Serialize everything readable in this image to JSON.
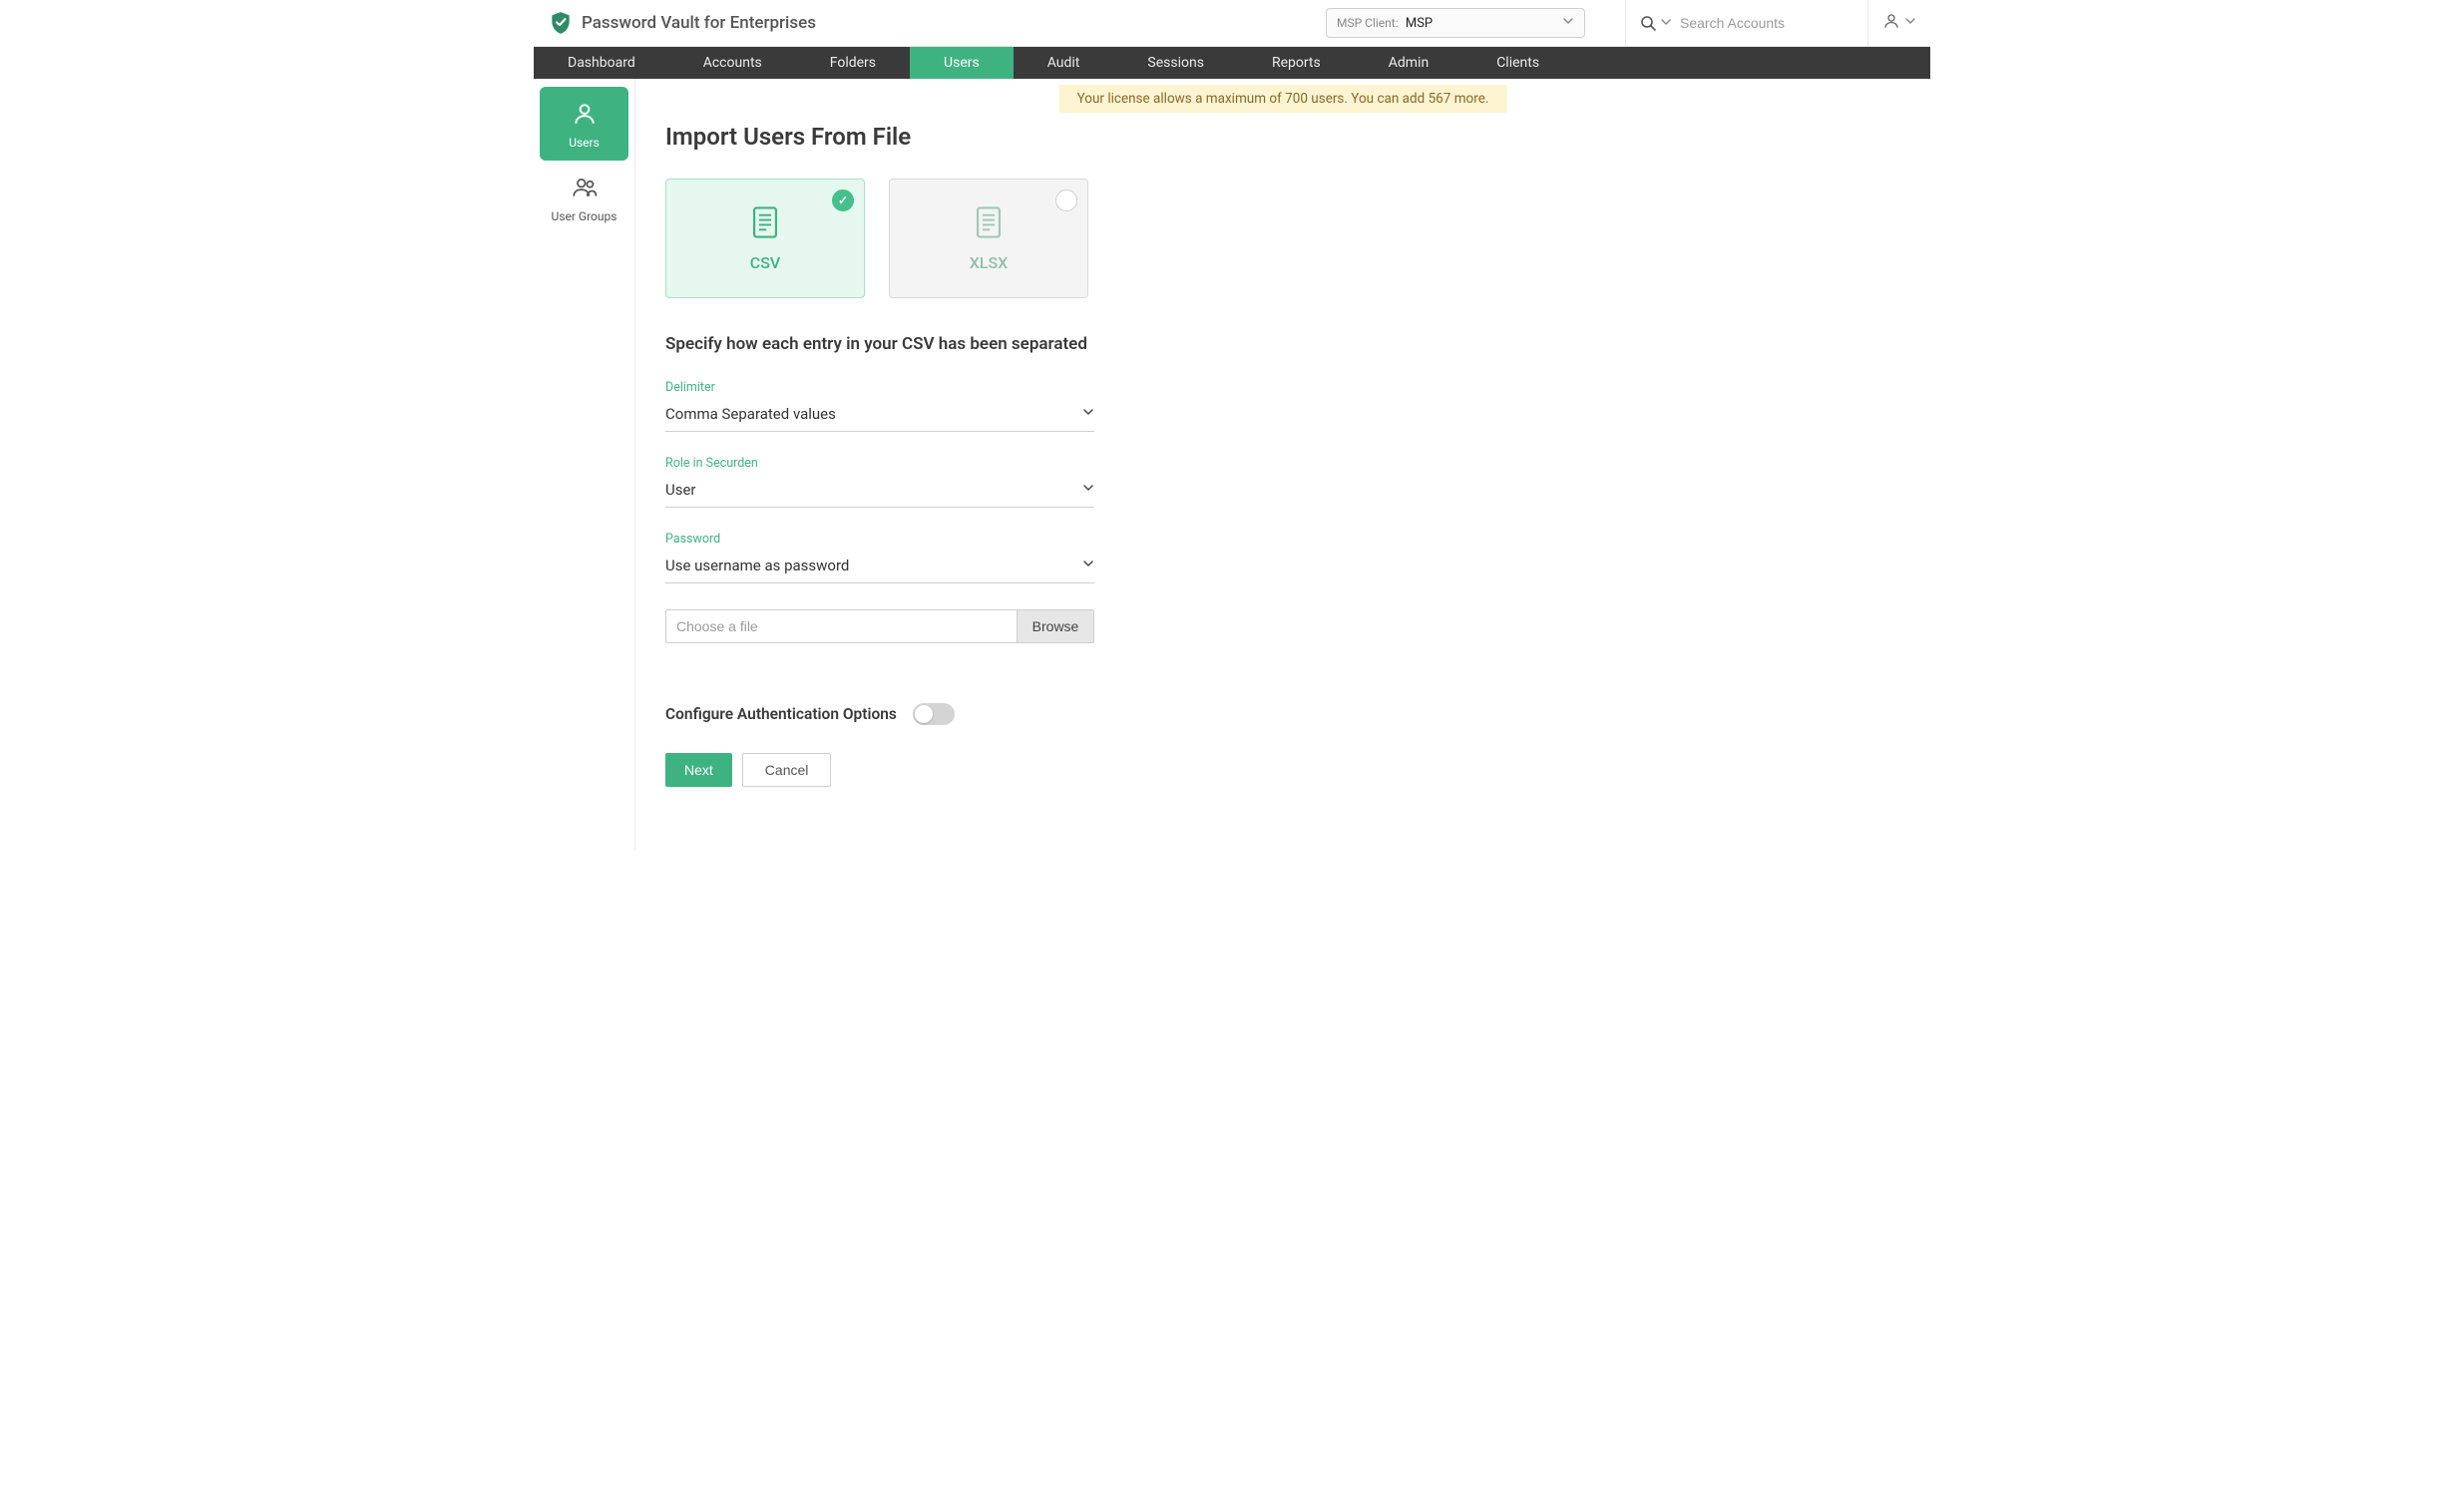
{
  "header": {
    "app_title": "Password Vault for Enterprises",
    "msp_label": "MSP Client:",
    "msp_value": "MSP",
    "search_placeholder": "Search Accounts"
  },
  "main_nav": [
    {
      "label": "Dashboard",
      "active": false
    },
    {
      "label": "Accounts",
      "active": false
    },
    {
      "label": "Folders",
      "active": false
    },
    {
      "label": "Users",
      "active": true
    },
    {
      "label": "Audit",
      "active": false
    },
    {
      "label": "Sessions",
      "active": false
    },
    {
      "label": "Reports",
      "active": false
    },
    {
      "label": "Admin",
      "active": false
    },
    {
      "label": "Clients",
      "active": false
    }
  ],
  "side_rail": {
    "users_label": "Users",
    "user_groups_label": "User Groups"
  },
  "license_banner": "Your license allows a maximum of 700 users. You can add 567 more.",
  "page": {
    "title": "Import Users From File",
    "format_csv": "CSV",
    "format_xlsx": "XLSX",
    "section_heading": "Specify how each entry in your CSV has been separated",
    "delimiter_label": "Delimiter",
    "delimiter_value": "Comma Separated values",
    "role_label": "Role in Securden",
    "role_value": "User",
    "password_label": "Password",
    "password_value": "Use username as password",
    "file_placeholder": "Choose a file",
    "browse_label": "Browse",
    "auth_toggle_label": "Configure Authentication Options",
    "next_label": "Next",
    "cancel_label": "Cancel"
  }
}
